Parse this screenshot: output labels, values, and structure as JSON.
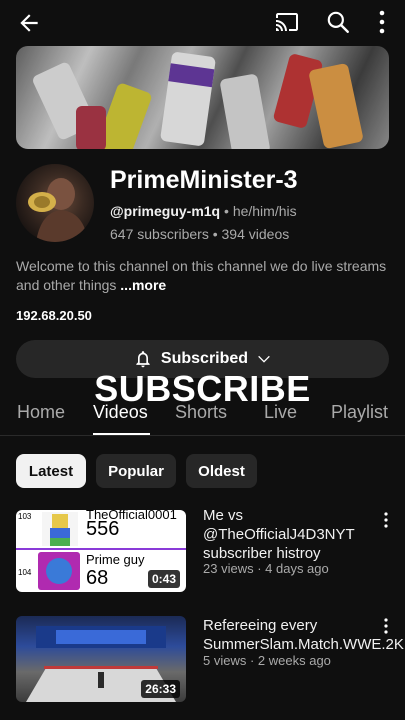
{
  "topbar": {
    "back_icon": "arrow-left-icon",
    "cast_icon": "cast-icon",
    "search_icon": "search-icon",
    "more_icon": "more-vert-icon"
  },
  "channel": {
    "name": "PrimeMinister-3",
    "handle": "@primeguy-m1q",
    "separator": "•",
    "pronouns": "he/him/his",
    "subscribers": "647 subscribers",
    "videos": "394 videos",
    "description": "Welcome to this channel on this channel we do live streams and other things ",
    "more_label": "...more",
    "link": "192.68.20.50"
  },
  "subscribe": {
    "label": "Subscribed",
    "bell_icon": "bell-icon",
    "chevron_icon": "chevron-down-icon"
  },
  "overlay_text": "SUBSCRIBE",
  "tabs": [
    {
      "label": "Home",
      "active": false
    },
    {
      "label": "Videos",
      "active": true
    },
    {
      "label": "Shorts",
      "active": false
    },
    {
      "label": "Live",
      "active": false
    },
    {
      "label": "Playlist",
      "active": false
    }
  ],
  "chips": [
    {
      "label": "Latest",
      "active": true
    },
    {
      "label": "Popular",
      "active": false
    },
    {
      "label": "Oldest",
      "active": false
    }
  ],
  "videos": [
    {
      "title": "Me vs @TheOfficialJ4D3NYT subscriber histroy",
      "views": "23 views",
      "age": "4 days ago",
      "duration": "0:43",
      "thumb_rows": [
        {
          "rank": "103",
          "name": "TheOfficial0001",
          "count": "556"
        },
        {
          "rank": "104",
          "name": "Prime guy",
          "count": "68"
        }
      ]
    },
    {
      "title": "Refereeing every SummerSlam.Match.WWE.2K.",
      "views": "5 views",
      "age": "2 weeks ago",
      "duration": "26:33"
    }
  ]
}
